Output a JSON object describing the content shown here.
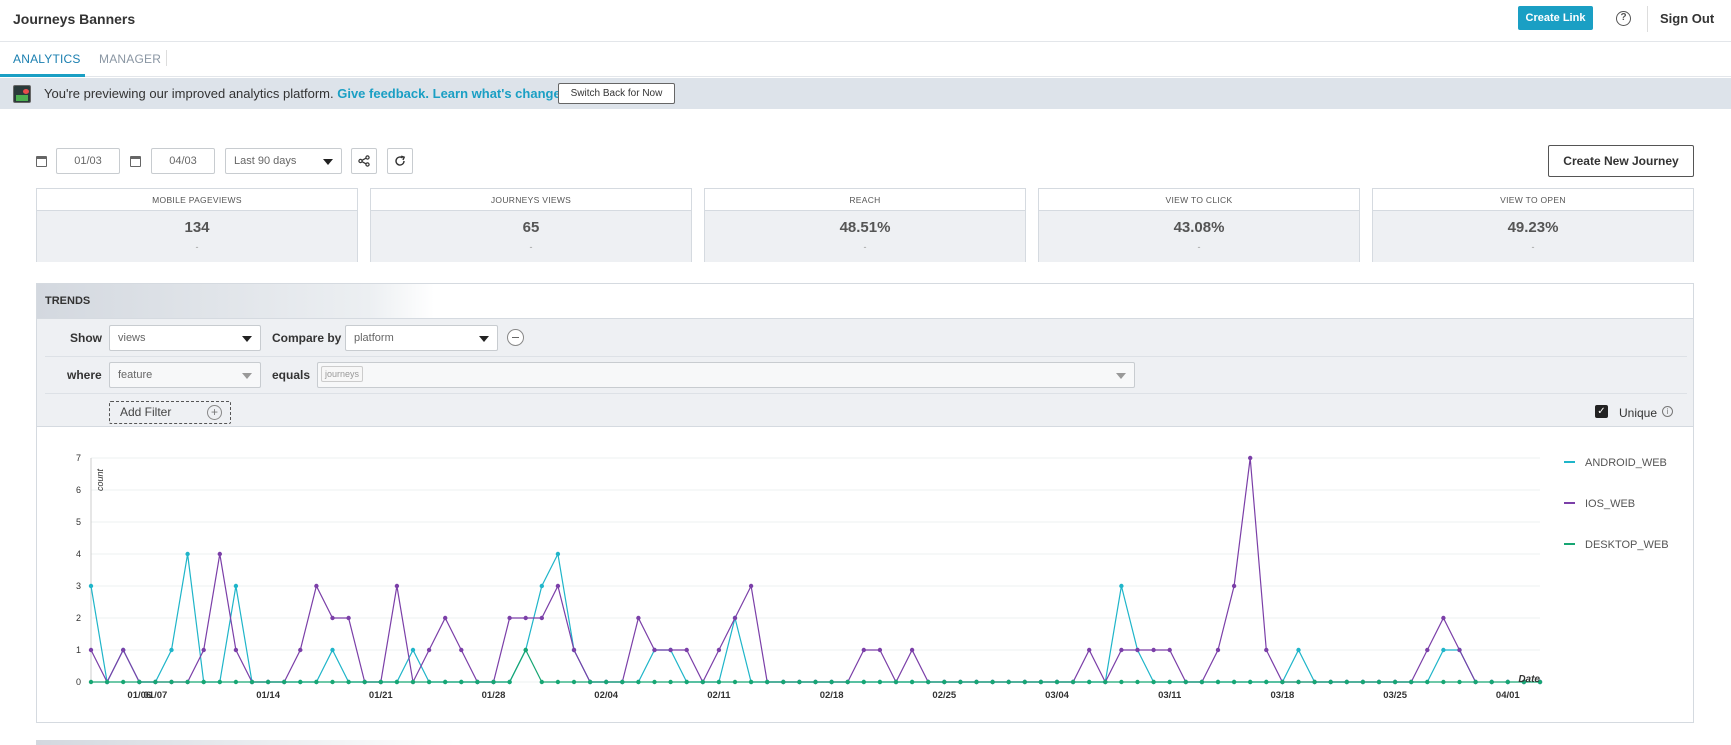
{
  "header": {
    "title": "Journeys Banners",
    "create_link": "Create Link",
    "sign_out": "Sign Out"
  },
  "tabs": [
    {
      "label": "ANALYTICS"
    },
    {
      "label": "MANAGER"
    }
  ],
  "banner": {
    "text": "You're previewing our improved analytics platform.",
    "feedback_link": "Give feedback.",
    "changes_link": "Learn what's changed.",
    "switch_button": "Switch Back for Now"
  },
  "filters": {
    "start_date": "01/03",
    "end_date": "04/03",
    "range": "Last 90 days",
    "create_journey": "Create New Journey"
  },
  "stats": [
    {
      "label": "MOBILE PAGEVIEWS",
      "value": "134",
      "delta": "-"
    },
    {
      "label": "JOURNEYS VIEWS",
      "value": "65",
      "delta": "-"
    },
    {
      "label": "REACH",
      "value": "48.51%",
      "delta": "-"
    },
    {
      "label": "VIEW TO CLICK",
      "value": "43.08%",
      "delta": "-"
    },
    {
      "label": "VIEW TO OPEN",
      "value": "49.23%",
      "delta": "-"
    }
  ],
  "trends": {
    "title": "TRENDS",
    "show_label": "Show",
    "show_value": "views",
    "compare_label": "Compare by",
    "compare_value": "platform",
    "where_label": "where",
    "where_value": "feature",
    "equals_label": "equals",
    "equals_tag": "journeys",
    "add_filter": "Add Filter",
    "unique_label": "Unique"
  },
  "colors": {
    "android": "#1fb5c9",
    "ios": "#7b3fa8",
    "desktop": "#17a673",
    "accent": "#1a9fc4"
  },
  "chart_data": {
    "type": "line",
    "ylabel": "count",
    "xlabel": "Date",
    "ylim": [
      0,
      7
    ],
    "y_ticks": [
      0,
      1,
      2,
      3,
      4,
      5,
      6,
      7
    ],
    "x_tick_labels": [
      "01/06",
      "01/07",
      "01/14",
      "01/21",
      "01/28",
      "02/04",
      "02/11",
      "02/18",
      "02/25",
      "03/04",
      "03/11",
      "03/18",
      "03/25",
      "04/01"
    ],
    "x_tick_index": [
      3,
      4,
      11,
      18,
      25,
      32,
      39,
      46,
      53,
      60,
      67,
      74,
      81,
      88
    ],
    "num_points": 91,
    "legend_position": "right",
    "series": [
      {
        "name": "ANDROID_WEB",
        "color": "#1fb5c9",
        "points": [
          [
            0,
            3
          ],
          [
            1,
            0
          ],
          [
            2,
            1
          ],
          [
            3,
            0
          ],
          [
            4,
            0
          ],
          [
            5,
            1
          ],
          [
            6,
            4
          ],
          [
            7,
            0
          ],
          [
            8,
            0
          ],
          [
            9,
            3
          ],
          [
            10,
            0
          ],
          [
            14,
            0
          ],
          [
            15,
            1
          ],
          [
            16,
            0
          ],
          [
            19,
            0
          ],
          [
            20,
            1
          ],
          [
            21,
            0
          ],
          [
            26,
            0
          ],
          [
            27,
            1
          ],
          [
            28,
            3
          ],
          [
            29,
            4
          ],
          [
            30,
            1
          ],
          [
            31,
            0
          ],
          [
            34,
            0
          ],
          [
            35,
            1
          ],
          [
            36,
            1
          ],
          [
            37,
            0
          ],
          [
            39,
            0
          ],
          [
            40,
            2
          ],
          [
            41,
            0
          ],
          [
            63,
            0
          ],
          [
            64,
            3
          ],
          [
            65,
            1
          ],
          [
            66,
            0
          ],
          [
            74,
            0
          ],
          [
            75,
            1
          ],
          [
            76,
            0
          ],
          [
            83,
            0
          ],
          [
            84,
            1
          ],
          [
            85,
            1
          ],
          [
            86,
            0
          ]
        ]
      },
      {
        "name": "IOS_WEB",
        "color": "#7b3fa8",
        "points": [
          [
            0,
            1
          ],
          [
            1,
            0
          ],
          [
            2,
            1
          ],
          [
            3,
            0
          ],
          [
            6,
            0
          ],
          [
            7,
            1
          ],
          [
            8,
            4
          ],
          [
            9,
            1
          ],
          [
            10,
            0
          ],
          [
            12,
            0
          ],
          [
            13,
            1
          ],
          [
            14,
            3
          ],
          [
            15,
            2
          ],
          [
            16,
            2
          ],
          [
            17,
            0
          ],
          [
            18,
            0
          ],
          [
            19,
            3
          ],
          [
            20,
            0
          ],
          [
            21,
            1
          ],
          [
            22,
            2
          ],
          [
            23,
            1
          ],
          [
            24,
            0
          ],
          [
            25,
            0
          ],
          [
            26,
            2
          ],
          [
            27,
            2
          ],
          [
            28,
            2
          ],
          [
            29,
            3
          ],
          [
            30,
            1
          ],
          [
            31,
            0
          ],
          [
            33,
            0
          ],
          [
            34,
            2
          ],
          [
            35,
            1
          ],
          [
            36,
            1
          ],
          [
            37,
            1
          ],
          [
            38,
            0
          ],
          [
            39,
            1
          ],
          [
            40,
            2
          ],
          [
            41,
            3
          ],
          [
            42,
            0
          ],
          [
            47,
            0
          ],
          [
            48,
            1
          ],
          [
            49,
            1
          ],
          [
            50,
            0
          ],
          [
            51,
            1
          ],
          [
            52,
            0
          ],
          [
            61,
            0
          ],
          [
            62,
            1
          ],
          [
            63,
            0
          ],
          [
            64,
            1
          ],
          [
            65,
            1
          ],
          [
            66,
            1
          ],
          [
            67,
            1
          ],
          [
            68,
            0
          ],
          [
            69,
            0
          ],
          [
            70,
            1
          ],
          [
            71,
            3
          ],
          [
            72,
            7
          ],
          [
            73,
            1
          ],
          [
            74,
            0
          ],
          [
            82,
            0
          ],
          [
            83,
            1
          ],
          [
            84,
            2
          ],
          [
            85,
            1
          ],
          [
            86,
            0
          ]
        ]
      },
      {
        "name": "DESKTOP_WEB",
        "color": "#17a673",
        "points": [
          [
            0,
            0
          ],
          [
            26,
            0
          ],
          [
            27,
            1
          ],
          [
            28,
            0
          ],
          [
            90,
            0
          ]
        ]
      }
    ]
  }
}
